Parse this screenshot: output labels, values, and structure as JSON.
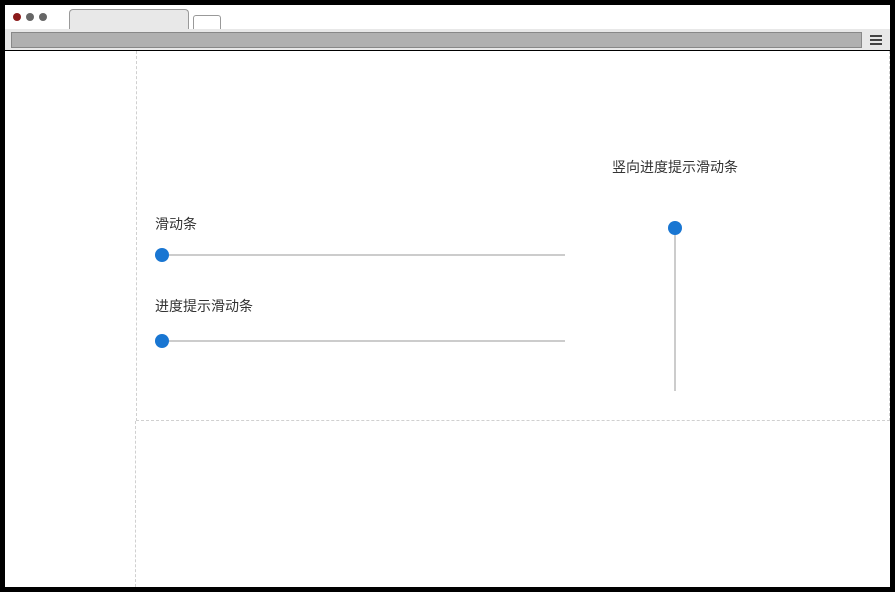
{
  "sliders": {
    "basic": {
      "label": "滑动条"
    },
    "progress": {
      "label": "进度提示滑动条"
    },
    "vertical_progress": {
      "label": "竖向进度提示滑动条"
    }
  },
  "colors": {
    "slider_thumb": "#1976d2",
    "slider_track": "#cccccc"
  }
}
